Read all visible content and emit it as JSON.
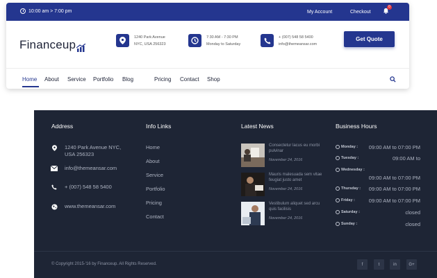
{
  "topbar": {
    "time": "10:00 am > 7:00 pm",
    "my_account": "My Account",
    "checkout": "Checkout",
    "cart_count": "0"
  },
  "logo": {
    "text": "Financeup"
  },
  "contact": [
    {
      "icon": "map-pin-icon",
      "line1": "1240 Park Avenue",
      "line2": "NYC, USA 256323"
    },
    {
      "icon": "clock-icon",
      "line1": "7:30 AM - 7:30 PM",
      "line2": "Monday to Saturday"
    },
    {
      "icon": "phone-icon",
      "line1": "+ (007) 548 58 5400",
      "line2": "info@themeansar.com"
    }
  ],
  "quote_button": "Get Quote",
  "nav": [
    "Home",
    "About",
    "Service",
    "Portfolio",
    "Blog",
    "Pricing",
    "Contact",
    "Shop"
  ],
  "footer": {
    "headings": {
      "address": "Address",
      "info_links": "Info Links",
      "latest_news": "Latest News",
      "business_hours": "Business Hours"
    },
    "address": [
      {
        "icon": "map-pin-icon",
        "text": "1240 Park Avenue NYC, USA 256323"
      },
      {
        "icon": "mail-icon",
        "text": "info@themeansar.com"
      },
      {
        "icon": "phone-icon",
        "text": "+ (007) 548 58 5400"
      },
      {
        "icon": "globe-icon",
        "text": "www.themeansar.com"
      }
    ],
    "info_links": [
      "Home",
      "About",
      "Service",
      "Portfolio",
      "Pricing",
      "Contact"
    ],
    "news": [
      {
        "title": "Consectetur lacus eu morbi pulvinar",
        "date": "November 24, 2016"
      },
      {
        "title": "Mauris malesuada sem vitae feugiat justo amet",
        "date": "November 24, 2016"
      },
      {
        "title": "Vestibulum aliquet sed arcu quis facilisis",
        "date": "November 24, 2016"
      }
    ],
    "hours": [
      {
        "day": "Monday :",
        "time": "09:00 AM to 07:00 PM"
      },
      {
        "day": "Tuesday :",
        "time": "09:00 AM to"
      },
      {
        "day": "Wednesday :",
        "time": "09:00 AM to 07:00 PM"
      },
      {
        "day": "Thursday :",
        "time": "09:00 AM to 07:00 PM"
      },
      {
        "day": "Friday :",
        "time": "09:00 AM to 07:00 PM"
      },
      {
        "day": "Saturday :",
        "time": "closed"
      },
      {
        "day": "Sunday :",
        "time": "closed"
      }
    ],
    "copyright": "© Copyright 2015-'16 by Financeup. All Rights Reserved.",
    "social": [
      "f",
      "t",
      "in",
      "G+"
    ]
  },
  "colors": {
    "primary": "#24368f",
    "footer_bg": "#1e2535",
    "badge": "#e3383d"
  }
}
